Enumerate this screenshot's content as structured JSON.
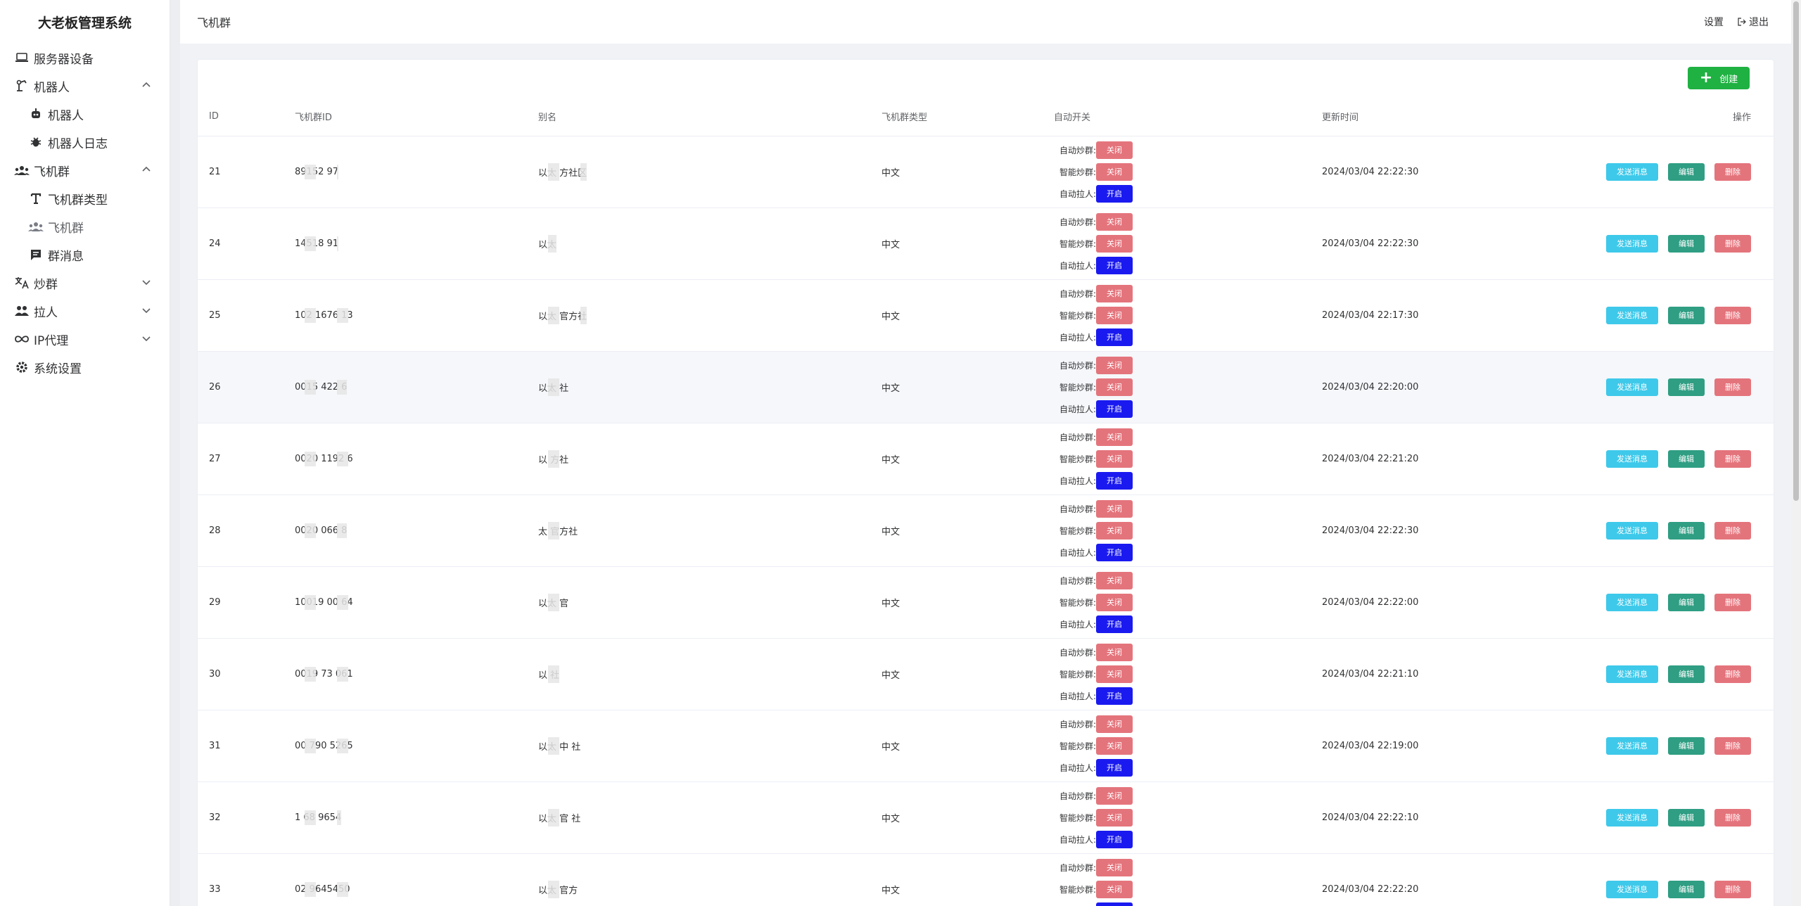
{
  "app": {
    "title": "大老板管理系统"
  },
  "sidebar": {
    "items": [
      {
        "label": "服务器设备",
        "icon": "laptop-icon"
      },
      {
        "label": "机器人",
        "icon": "robot-arm-icon",
        "expanded": true
      },
      {
        "label": "机器人",
        "icon": "robot-icon",
        "sub": true
      },
      {
        "label": "机器人日志",
        "icon": "bug-icon",
        "sub": true
      },
      {
        "label": "飞机群",
        "icon": "users-icon",
        "expanded": true
      },
      {
        "label": "飞机群类型",
        "icon": "text-icon",
        "sub": true
      },
      {
        "label": "飞机群",
        "icon": "users-icon",
        "sub": true,
        "active": true
      },
      {
        "label": "群消息",
        "icon": "chat-icon",
        "sub": true
      },
      {
        "label": "炒群",
        "icon": "translate-icon",
        "expanded": false
      },
      {
        "label": "拉人",
        "icon": "people-icon",
        "expanded": false
      },
      {
        "label": "IP代理",
        "icon": "infinity-icon",
        "expanded": false
      },
      {
        "label": "系统设置",
        "icon": "gear-icon"
      }
    ]
  },
  "header": {
    "title": "飞机群",
    "settings": "设置",
    "logout": "退出"
  },
  "toolbar": {
    "create": "创建"
  },
  "table": {
    "columns": {
      "id": "ID",
      "group_id": "飞机群ID",
      "alias": "别名",
      "type": "飞机群类型",
      "switch": "自动开关",
      "updated": "更新时间",
      "ops": "操作"
    },
    "switch_labels": {
      "auto_chat": "自动炒群:",
      "smart_chat": "智能炒群:",
      "auto_pull": "自动拉人:"
    },
    "switch_values": {
      "off": "关闭",
      "on": "开启"
    },
    "op_labels": {
      "send": "发送消息",
      "edit": "编辑",
      "delete": "删除"
    },
    "rows": [
      {
        "id": "21",
        "group_id": "89152 97",
        "alias": "以太 方社区",
        "type": "中文",
        "updated": "2024/03/04 22:22:30"
      },
      {
        "id": "24",
        "group_id": "14518 91",
        "alias": "以太",
        "type": "中文",
        "updated": "2024/03/04 22:22:30"
      },
      {
        "id": "25",
        "group_id": "102 1676 13",
        "alias": "以太 官方社",
        "type": "中文",
        "updated": "2024/03/04 22:17:30"
      },
      {
        "id": "26",
        "group_id": "0015 422 6",
        "alias": "以太 社",
        "type": "中文",
        "updated": "2024/03/04 22:20:00"
      },
      {
        "id": "27",
        "group_id": "0020 1192 6",
        "alias": "以 方社",
        "type": "中文",
        "updated": "2024/03/04 22:21:20"
      },
      {
        "id": "28",
        "group_id": "0020 066 8",
        "alias": "太 官方社",
        "type": "中文",
        "updated": "2024/03/04 22:22:30"
      },
      {
        "id": "29",
        "group_id": "10019 00 64",
        "alias": "以太 官",
        "type": "中文",
        "updated": "2024/03/04 22:22:00"
      },
      {
        "id": "30",
        "group_id": "0019 73 061",
        "alias": "以 社",
        "type": "中文",
        "updated": "2024/03/04 22:21:10"
      },
      {
        "id": "31",
        "group_id": "00 790 5265",
        "alias": "以太 中 社",
        "type": "中文",
        "updated": "2024/03/04 22:19:00"
      },
      {
        "id": "32",
        "group_id": "1 68 9654",
        "alias": "以太 官 社",
        "type": "中文",
        "updated": "2024/03/04 22:22:10"
      },
      {
        "id": "33",
        "group_id": "02 9645450",
        "alias": "以太 官方",
        "type": "中文",
        "updated": "2024/03/04 22:22:20"
      }
    ]
  },
  "colors": {
    "create": "#1fb142",
    "off": "#e4747c",
    "on": "#1a1af0",
    "send": "#3ec9ea",
    "edit": "#2f9e83"
  }
}
